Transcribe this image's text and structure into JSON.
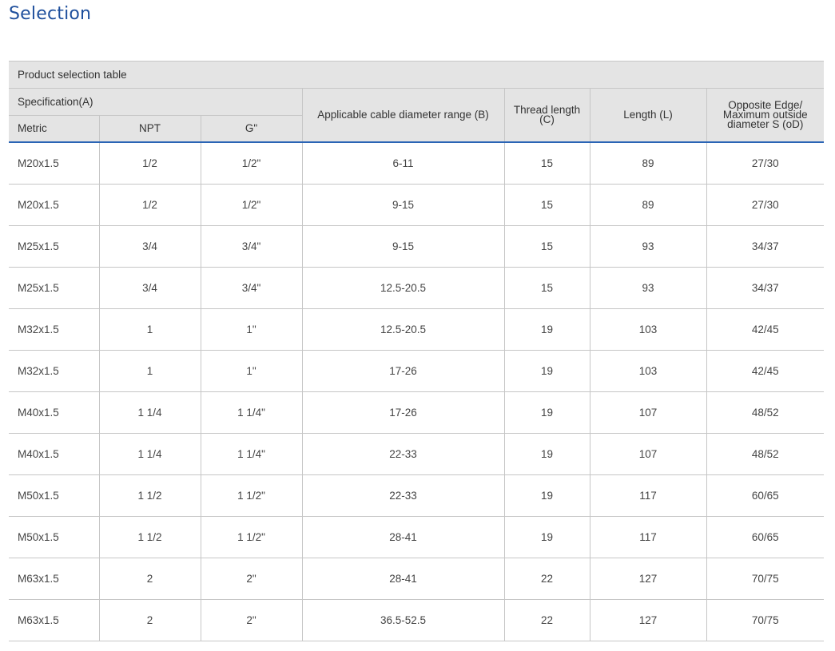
{
  "page": {
    "title": "Selection"
  },
  "table": {
    "caption": "Product selection table",
    "headers": {
      "specification": "Specification(A)",
      "metric": "Metric",
      "npt": "NPT",
      "g": "G\"",
      "cable_range": "Applicable cable diameter range (B)",
      "thread_length": "Thread length (C)",
      "length": "Length  (L)",
      "opposite_edge": "Opposite Edge/ Maximum outside diameter S (oD)"
    },
    "rows": [
      [
        "M20x1.5",
        "1/2",
        "1/2\"",
        "6-11",
        "15",
        "89",
        "27/30"
      ],
      [
        "M20x1.5",
        "1/2",
        "1/2\"",
        "9-15",
        "15",
        "89",
        "27/30"
      ],
      [
        "M25x1.5",
        "3/4",
        "3/4\"",
        "9-15",
        "15",
        "93",
        "34/37"
      ],
      [
        "M25x1.5",
        "3/4",
        "3/4\"",
        "12.5-20.5",
        "15",
        "93",
        "34/37"
      ],
      [
        "M32x1.5",
        "1",
        "1\"",
        "12.5-20.5",
        "19",
        "103",
        "42/45"
      ],
      [
        "M32x1.5",
        "1",
        "1\"",
        "17-26",
        "19",
        "103",
        "42/45"
      ],
      [
        "M40x1.5",
        "1 1/4",
        "1 1/4\"",
        "17-26",
        "19",
        "107",
        "48/52"
      ],
      [
        "M40x1.5",
        "1 1/4",
        "1 1/4\"",
        "22-33",
        "19",
        "107",
        "48/52"
      ],
      [
        "M50x1.5",
        "1 1/2",
        "1 1/2\"",
        "22-33",
        "19",
        "117",
        "60/65"
      ],
      [
        "M50x1.5",
        "1 1/2",
        "1 1/2\"",
        "28-41",
        "19",
        "117",
        "60/65"
      ],
      [
        "M63x1.5",
        "2",
        "2\"",
        "28-41",
        "22",
        "127",
        "70/75"
      ],
      [
        "M63x1.5",
        "2",
        "2\"",
        "36.5-52.5",
        "22",
        "127",
        "70/75"
      ]
    ]
  },
  "colors": {
    "title": "#1e4f9c",
    "header_background": "#e4e4e4",
    "header_rule": "#2a64b5",
    "grid": "#c6c6c6"
  }
}
